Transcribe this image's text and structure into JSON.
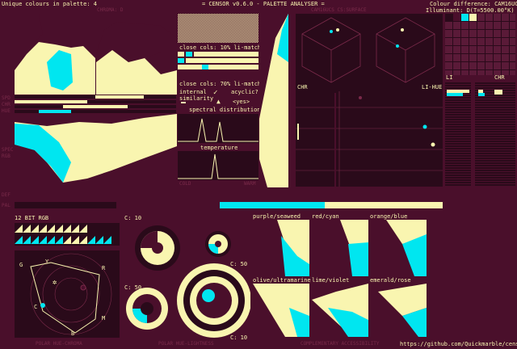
{
  "header": {
    "unique_colours": "Unique colours in palette: 4",
    "app_title": "= CENSOR v0.6.0 - PALETTE ANALYSER =",
    "colour_difference": "Colour difference: CAM16UCS",
    "illuminant": "Illuminant: D(T=5500.00°K)"
  },
  "top_labels": {
    "chroma": "CHROMA: D",
    "cam_space": "CAM16UCS CS:SURFACE"
  },
  "left_labels": {
    "l1": "SPD",
    "l2": "CHR",
    "l3": "HUE",
    "l4": "SPEC",
    "l5": "RGB",
    "l6": "DEF",
    "l7": "PAL"
  },
  "center_panel": {
    "close_cols_1": "close cols: 10% li-match",
    "close_cols_2": "close cols: 70% li-match",
    "internal_similarity": "internal similarity",
    "acyclic": "acyclic?",
    "yes": "<yes>",
    "spectral_distribution": "spectral distribution",
    "temperature": "temperature",
    "cold": "COLD",
    "warm": "WARM"
  },
  "scatter_labels": {
    "chr": "CHR",
    "li_hue": "LI-HUE",
    "li": "LI",
    "chr2": "CHR"
  },
  "bottom_left": {
    "rgb_title": "12 BIT RGB",
    "polar_title": "POLAR HUE-CHROMA",
    "polar_letters": [
      "G",
      "Y",
      "R",
      "C",
      "B",
      "M"
    ]
  },
  "circles": {
    "c10_a": "C: 10",
    "c50_a": "C: 50",
    "c50_b": "C: 50",
    "c10_b": "C: 10",
    "title": "POLAR HUE-LIGHTNESS"
  },
  "cvd": {
    "p1": "purple/seaweed",
    "p2": "red/cyan",
    "p3": "orange/blue",
    "p4": "olive/ultramarine",
    "p5": "lime/violet",
    "p6": "emerald/rose",
    "title": "COMPLEMENTARY ACCESSIBILITY"
  },
  "footer": {
    "url": "https://github.com/Quickmarble/censor"
  },
  "palette": {
    "colors": [
      "#2a0a1a",
      "#4a0f2b",
      "#00e6f0",
      "#f9f5b0"
    ]
  },
  "color_accents": {
    "wine": "#4a0f2b",
    "dark": "#2a0a1a",
    "cyan": "#00e6f0",
    "cream": "#f9f5b0"
  }
}
